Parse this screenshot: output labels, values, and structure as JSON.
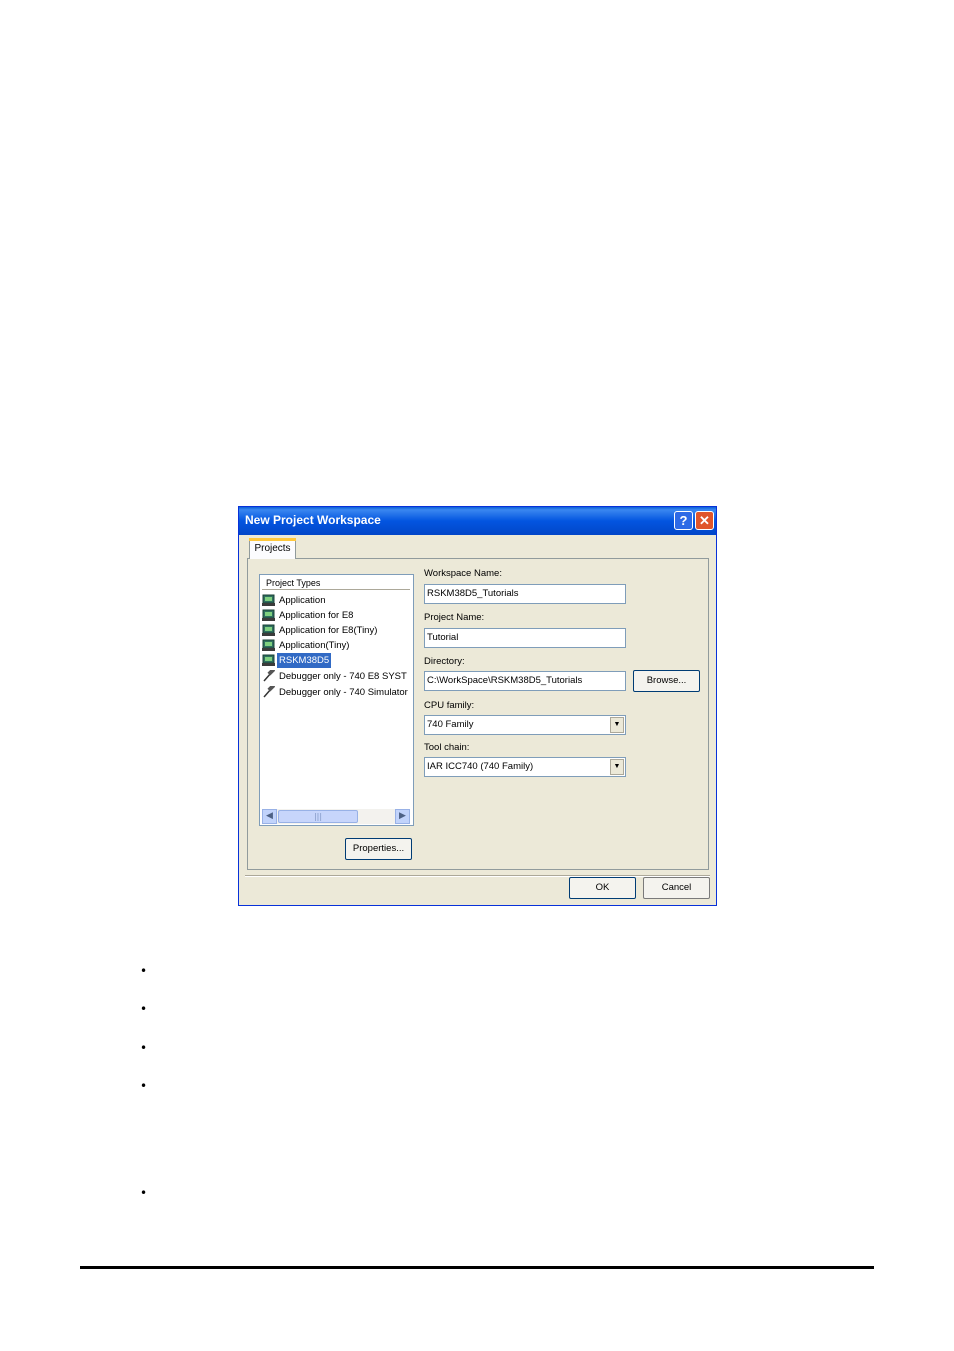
{
  "dialog": {
    "title": "New Project Workspace",
    "help_glyph": "?",
    "close_glyph": "✕",
    "tab_label": "Projects",
    "project_types_header": "Project Types",
    "project_types": [
      {
        "label": "Application",
        "icon": "application-icon",
        "selected": false
      },
      {
        "label": "Application for E8",
        "icon": "application-icon",
        "selected": false
      },
      {
        "label": "Application for E8(Tiny)",
        "icon": "application-icon",
        "selected": false
      },
      {
        "label": "Application(Tiny)",
        "icon": "application-icon",
        "selected": false
      },
      {
        "label": "RSKM38D5",
        "icon": "application-icon",
        "selected": true
      },
      {
        "label": "Debugger only - 740 E8 SYST",
        "icon": "hammer-icon",
        "selected": false
      },
      {
        "label": "Debugger only - 740 Simulator",
        "icon": "hammer-icon",
        "selected": false
      }
    ],
    "workspace_name_label": "Workspace Name:",
    "workspace_name_value": "RSKM38D5_Tutorials",
    "project_name_label": "Project Name:",
    "project_name_value": "Tutorial",
    "directory_label": "Directory:",
    "directory_value": "C:\\WorkSpace\\RSKM38D5_Tutorials",
    "browse_label": "Browse...",
    "cpu_family_label": "CPU family:",
    "cpu_family_value": "740 Family",
    "tool_chain_label": "Tool chain:",
    "tool_chain_value": "IAR ICC740 (740 Family)",
    "properties_label": "Properties...",
    "ok_label": "OK",
    "cancel_label": "Cancel",
    "combo_arrow_glyph": "▼",
    "scroll_left_glyph": "◀",
    "scroll_right_glyph": "▶",
    "scroll_thumb_grip": "|||"
  },
  "page": {
    "bullet_glyph": "•"
  }
}
